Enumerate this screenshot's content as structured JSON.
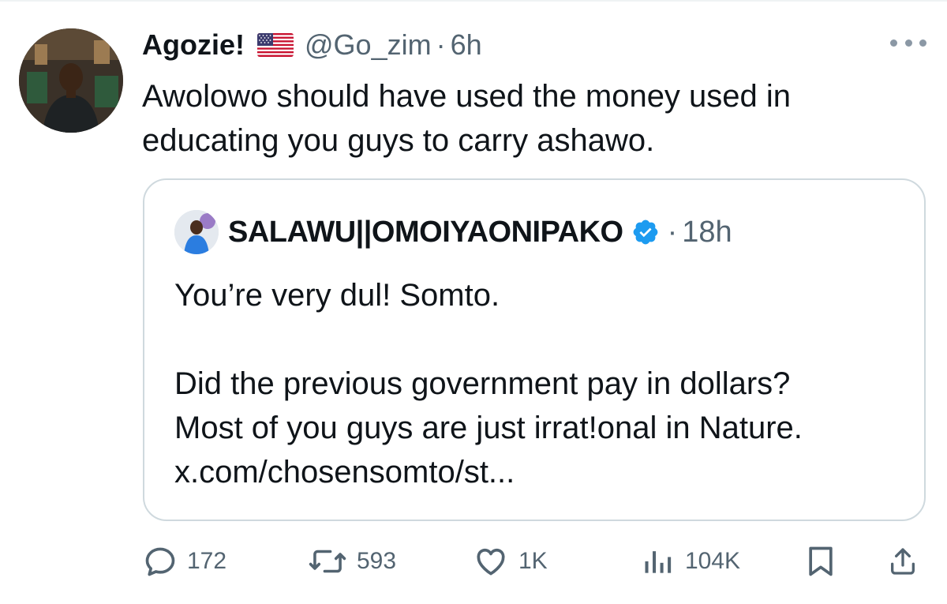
{
  "tweet": {
    "author": {
      "display_name": "Agozie!",
      "flag_icon": "us-flag-icon",
      "handle": "@Go_zim",
      "time": "6h"
    },
    "text": "Awolowo should have used the money used in educating you guys to carry ashawo.",
    "more_icon": "more-horizontal-icon"
  },
  "quote": {
    "author": {
      "display_name": "SALAWU||OMOIYAONIPAKO",
      "verified_icon": "verified-badge-icon",
      "time": "18h"
    },
    "lines": [
      "You’re very dul!  Somto.",
      "",
      "Did the previous government pay in dollars?",
      "Most of you guys are just irrat!onal in Nature.",
      "x.com/chosensomto/st..."
    ]
  },
  "actions": {
    "reply": {
      "icon": "reply-icon",
      "count": "172"
    },
    "retweet": {
      "icon": "retweet-icon",
      "count": "593"
    },
    "like": {
      "icon": "heart-icon",
      "count": "1K"
    },
    "views": {
      "icon": "views-icon",
      "count": "104K"
    },
    "bookmark": {
      "icon": "bookmark-icon"
    },
    "share": {
      "icon": "share-icon"
    }
  },
  "colors": {
    "text_primary": "#0f1419",
    "text_secondary": "#536471",
    "border": "#cfd9de",
    "verified": "#1d9bf0"
  }
}
